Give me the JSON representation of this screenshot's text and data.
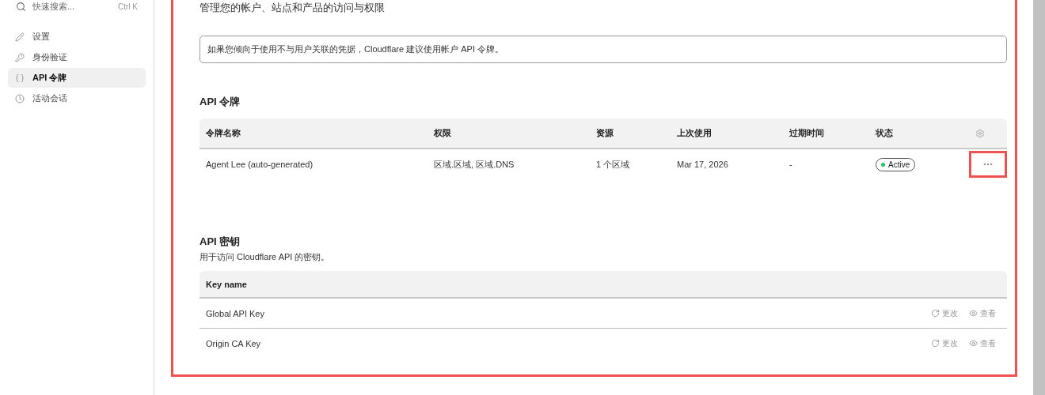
{
  "sidebar": {
    "search": {
      "placeholder": "快速搜索...",
      "shortcut": "Ctrl K"
    },
    "items": [
      {
        "label": "设置",
        "selected": false
      },
      {
        "label": "身份验证",
        "selected": false
      },
      {
        "label": "API 令牌",
        "selected": true
      },
      {
        "label": "活动会话",
        "selected": false
      }
    ]
  },
  "main": {
    "highlighted": true,
    "subtitle": "管理您的帐户、站点和产品的访问与权限",
    "notice": "如果您倾向于使用不与用户关联的凭据，Cloudflare 建议使用帐户 API 令牌。",
    "tokens": {
      "title": "API 令牌",
      "columns": [
        "令牌名称",
        "权限",
        "资源",
        "上次使用",
        "过期时间",
        "状态"
      ],
      "rows": [
        {
          "cells": [
            "Agent Lee (auto-generated)",
            "区域.区域, 区域.DNS",
            "1 个区域",
            "Mar 17, 2026",
            "-"
          ],
          "status": "Active",
          "color": "#22c55e",
          "menu_highlighted": true
        }
      ]
    },
    "keys": {
      "title": "API 密钥",
      "description": "用于访问 Cloudflare API 的密钥。",
      "column": "Key name",
      "rows": [
        {
          "name": "Global API Key",
          "actions": [
            "更改",
            "查看"
          ]
        },
        {
          "name": "Origin CA Key",
          "actions": [
            "更改",
            "查看"
          ]
        }
      ]
    }
  }
}
